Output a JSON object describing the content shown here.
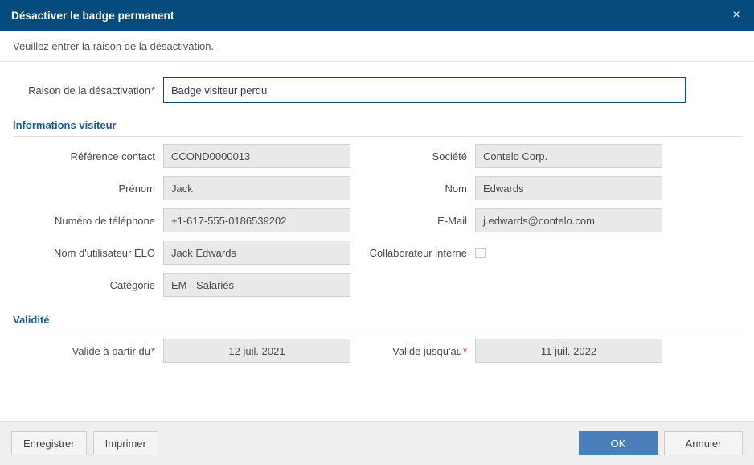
{
  "titlebar": {
    "title": "Désactiver le badge permanent",
    "close_label": "×"
  },
  "instruction": "Veuillez entrer la raison de la désactivation.",
  "reason": {
    "label": "Raison de la désactivation",
    "required_mark": "*",
    "value": "Badge visiteur perdu"
  },
  "sections": [
    {
      "title": "Informations visiteur"
    },
    {
      "title": "Validité"
    }
  ],
  "visitor": {
    "left": [
      {
        "label": "Référence contact",
        "value": "CCOND0000013"
      },
      {
        "label": "Prénom",
        "value": "Jack"
      },
      {
        "label": "Numéro de téléphone",
        "value": "+1-617-555-0186539202"
      },
      {
        "label": "Nom d'utilisateur ELO",
        "value": "Jack Edwards"
      },
      {
        "label": "Catégorie",
        "value": "EM - Salariés"
      }
    ],
    "right": [
      {
        "label": "Société",
        "value": "Contelo Corp."
      },
      {
        "label": "Nom",
        "value": "Edwards"
      },
      {
        "label": "E-Mail",
        "value": "j.edwards@contelo.com"
      }
    ],
    "internal_collaborator": {
      "label": "Collaborateur interne",
      "checked": false
    }
  },
  "validity": {
    "from": {
      "label": "Valide à partir du",
      "required_mark": "*",
      "value": "12 juil. 2021"
    },
    "to": {
      "label": "Valide jusqu'au",
      "required_mark": "*",
      "value": "11 juil. 2022"
    }
  },
  "footer": {
    "save_label": "Enregistrer",
    "print_label": "Imprimer",
    "ok_label": "OK",
    "cancel_label": "Annuler"
  },
  "colors": {
    "titlebar": "#064b7d",
    "section_heading": "#1a5b92",
    "primary_button": "#4a7fbb",
    "required_asterisk": "#b03030",
    "readonly_field": "#e8e9ea",
    "footer_background": "#efefef"
  }
}
